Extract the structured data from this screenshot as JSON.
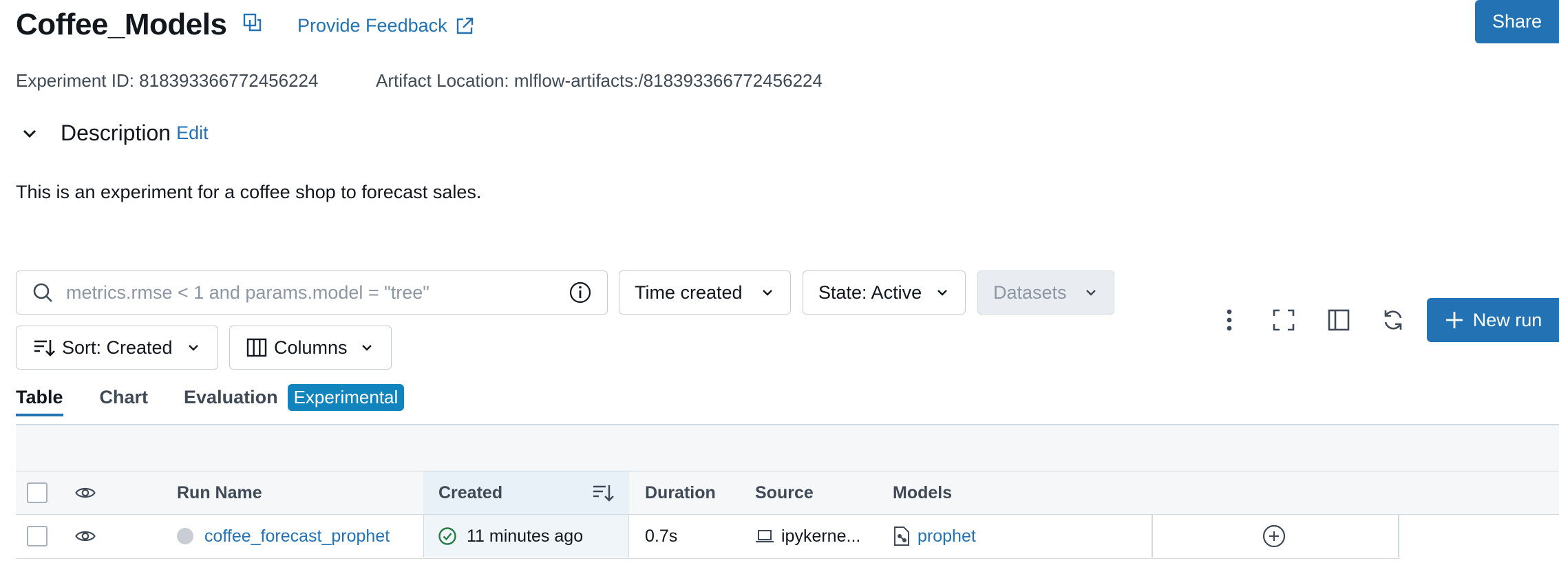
{
  "header": {
    "title": "Coffee_Models",
    "feedback_label": "Provide Feedback",
    "share_label": "Share",
    "experiment_id": "Experiment ID: 818393366772456224",
    "artifact_location": "Artifact Location: mlflow-artifacts:/818393366772456224"
  },
  "description": {
    "label": "Description",
    "edit_label": "Edit",
    "text": "This is an experiment for a coffee shop to forecast sales."
  },
  "filters": {
    "search_placeholder": "metrics.rmse < 1 and params.model = \"tree\"",
    "time_created": "Time created",
    "state": "State: Active",
    "datasets": "Datasets",
    "sort": "Sort: Created",
    "columns": "Columns"
  },
  "toolbar": {
    "new_run_label": "New run",
    "icons": [
      "more-vertical-icon",
      "fullscreen-icon",
      "sidebar-icon",
      "refresh-icon",
      "plus-icon"
    ]
  },
  "tabs": {
    "table": "Table",
    "chart": "Chart",
    "evaluation": "Evaluation",
    "experimental_badge": "Experimental"
  },
  "table": {
    "headers": {
      "run_name": "Run Name",
      "created": "Created",
      "duration": "Duration",
      "source": "Source",
      "models": "Models"
    },
    "rows": [
      {
        "run_name": "coffee_forecast_prophet",
        "created": "11 minutes ago",
        "duration": "0.7s",
        "source": "ipykerne...",
        "model": "prophet"
      }
    ]
  },
  "colors": {
    "accent": "#2272b4",
    "badge": "#1184bd",
    "success": "#277c43",
    "border": "#d1d9e1"
  }
}
